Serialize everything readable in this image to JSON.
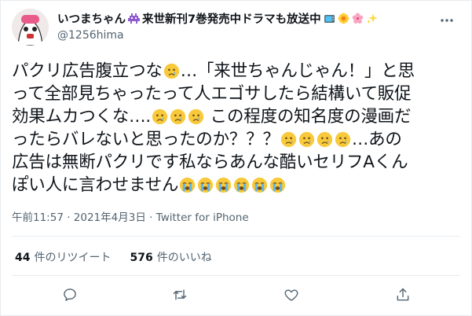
{
  "author": {
    "display_name": "いつまちゃん👾来世新刊7巻発売中ドラマも放送中📺🌼🌸✨",
    "name_text": "いつまちゃん",
    "name_suffix_text": "来世新刊7巻発売中ドラマも放送中",
    "handle": "@1256hima"
  },
  "tweet": {
    "lines": [
      [
        "パクリ広告腹立つな",
        "😢",
        "…「来世ちゃんじゃん！」と思"
      ],
      [
        "って全部見ちゃったって人エゴサしたら結構いて販促"
      ],
      [
        "効果ムカつくな….",
        "😢",
        "😢",
        "😢",
        " この程度の知名度の漫画だ"
      ],
      [
        "ったらバレないと思ったのか？？？",
        "😢",
        "😢",
        "😢",
        "😢",
        "…あの"
      ],
      [
        "広告は無断パクリです私ならあんな酷いセリフAくん"
      ],
      [
        "ぽい人に言わせません",
        "😭",
        "😭",
        "😭",
        "😭",
        "😭",
        "😭"
      ]
    ],
    "timestamp": "午前11:57 · 2021年4月3日 · Twitter for iPhone"
  },
  "stats": {
    "retweets_count": "44",
    "retweets_label": "件のリツイート",
    "likes_count": "576",
    "likes_label": "件のいいね"
  },
  "icons": {
    "more": "more-icon",
    "reply": "reply-icon",
    "retweet": "retweet-icon",
    "like": "heart-icon",
    "share": "share-icon"
  },
  "colors": {
    "text_primary": "#0f1419",
    "text_secondary": "#536471",
    "border": "#e6ecf0",
    "emoji_face": "#f8c93a"
  }
}
